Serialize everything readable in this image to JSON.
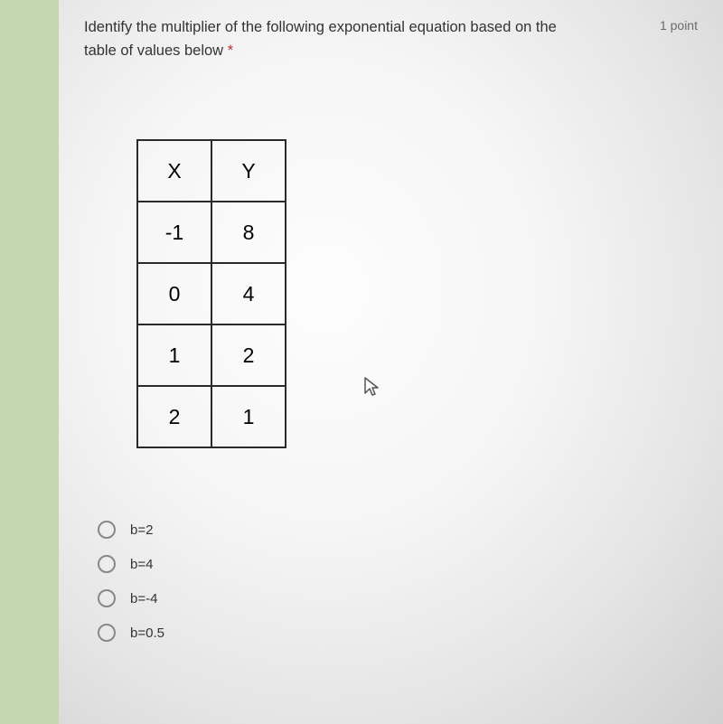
{
  "question": {
    "line1": "Identify the multiplier of the following exponential equation based on the",
    "line2": "table of values below ",
    "required_marker": "*"
  },
  "points": "1 point",
  "table": {
    "header": {
      "x": "X",
      "y": "Y"
    },
    "rows": [
      {
        "x": "-1",
        "y": "8"
      },
      {
        "x": "0",
        "y": "4"
      },
      {
        "x": "1",
        "y": "2"
      },
      {
        "x": "2",
        "y": "1"
      }
    ]
  },
  "options": [
    {
      "label": "b=2"
    },
    {
      "label": "b=4"
    },
    {
      "label": "b=-4"
    },
    {
      "label": "b=0.5"
    }
  ]
}
